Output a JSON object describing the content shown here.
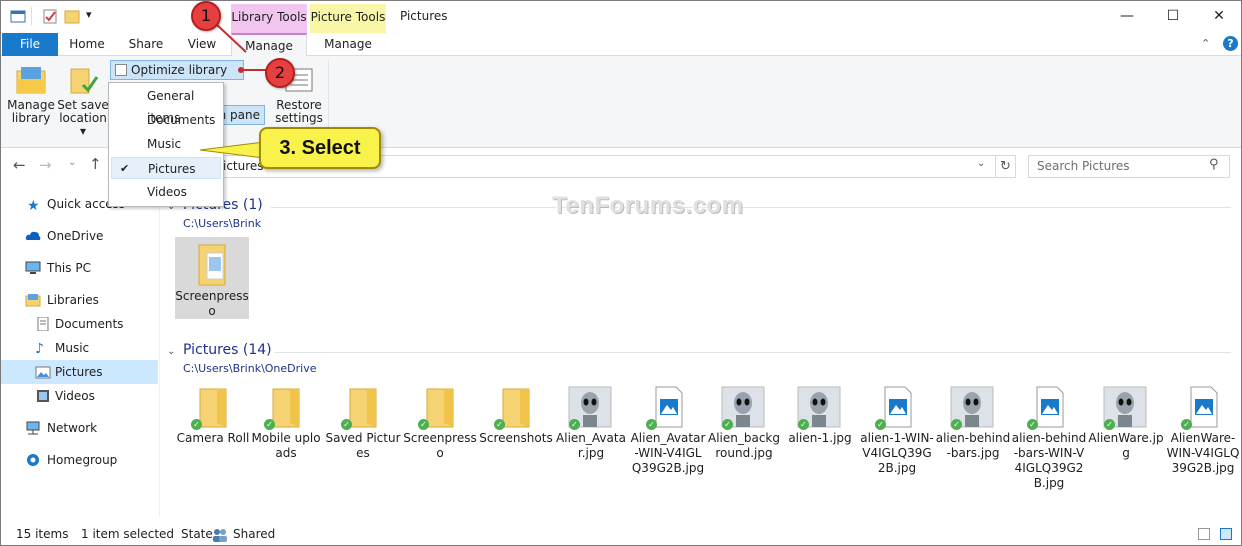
{
  "window": {
    "title": "Pictures",
    "context_tabs": {
      "library_tools": "Library Tools",
      "picture_tools": "Picture Tools"
    },
    "controls": {
      "minimize": "—",
      "maximize": "☐",
      "close": "✕"
    }
  },
  "ribbon_tabs": {
    "file": "File",
    "home": "Home",
    "share": "Share",
    "view": "View",
    "manage_library": "Manage",
    "manage_picture": "Manage"
  },
  "ribbon": {
    "manage_library_label": "Manage\nlibrary",
    "set_save_label": "Set save\nlocation ▾",
    "optimize_label": "Optimize library for",
    "nav_pane_label": "n pane",
    "restore_label": "Restore\nsettings"
  },
  "optimize_menu": {
    "items": [
      "General items",
      "Documents",
      "Music",
      "Pictures",
      "Videos"
    ],
    "selected": "Pictures",
    "check_mark": "✔"
  },
  "address": {
    "path": "ictures",
    "search_placeholder": "Search Pictures"
  },
  "nav": {
    "quick_access": "Quick access",
    "onedrive": "OneDrive",
    "this_pc": "This PC",
    "libraries": "Libraries",
    "documents": "Documents",
    "music": "Music",
    "pictures": "Pictures",
    "videos": "Videos",
    "network": "Network",
    "homegroup": "Homegroup"
  },
  "groups": [
    {
      "title": "Pictures (1)",
      "path": "C:\\Users\\Brink",
      "items": [
        {
          "label": "Screenpresso",
          "type": "folder",
          "selected": true
        }
      ]
    },
    {
      "title": "Pictures (14)",
      "path": "C:\\Users\\Brink\\OneDrive",
      "items": [
        {
          "label": "Camera Roll",
          "type": "folder"
        },
        {
          "label": "Mobile uploads",
          "type": "folder"
        },
        {
          "label": "Saved Pictures",
          "type": "folder"
        },
        {
          "label": "Screenpresso",
          "type": "folder"
        },
        {
          "label": "Screenshots",
          "type": "folder"
        },
        {
          "label": "Alien_Avatar.jpg",
          "type": "photo"
        },
        {
          "label": "Alien_Avatar-WIN-V4IGLQ39G2B.jpg",
          "type": "image"
        },
        {
          "label": "Alien_background.jpg",
          "type": "photo"
        },
        {
          "label": "alien-1.jpg",
          "type": "photo"
        },
        {
          "label": "alien-1-WIN-V4IGLQ39G2B.jpg",
          "type": "image"
        },
        {
          "label": "alien-behind-bars.jpg",
          "type": "photo"
        },
        {
          "label": "alien-behind-bars-WIN-V4IGLQ39G2B.jpg",
          "type": "image"
        },
        {
          "label": "AlienWare.jpg",
          "type": "photo"
        },
        {
          "label": "AlienWare-WIN-V4IGLQ39G2B.jpg",
          "type": "image"
        }
      ]
    }
  ],
  "status": {
    "item_count": "15 items",
    "selection": "1 item selected",
    "state_label": "State:",
    "state_value": "Shared"
  },
  "annotations": {
    "step1": "1",
    "step2": "2",
    "step3": "3. Select"
  },
  "watermark": "TenForums.com",
  "colors": {
    "file_tab": "#1979ca",
    "library_tools": "#f1c5f0",
    "picture_tools": "#f9f6a8",
    "selection": "#cce8ff",
    "callout_red": "#e63f3f",
    "callout_yellow": "#f8f24a"
  }
}
